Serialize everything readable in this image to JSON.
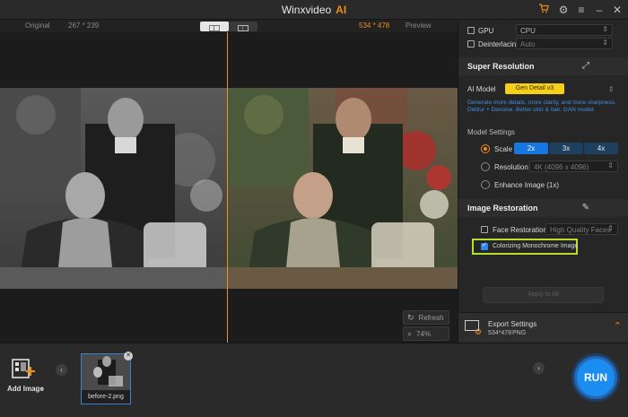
{
  "app": {
    "title": "Winxvideo",
    "title_accent": "AI"
  },
  "titlebar_icons": [
    "cart-icon",
    "gear-icon",
    "menu-icon",
    "minimize-icon",
    "close-icon"
  ],
  "preview_header": {
    "original_label": "Original",
    "original_size": "267 * 239",
    "output_size": "534 * 478",
    "preview_label": "Preview"
  },
  "preview_controls": {
    "refresh": "Refresh",
    "zoom": "74%"
  },
  "settings": {
    "gpu_label": "GPU",
    "gpu_value": "CPU",
    "deinterlacing_label": "Deinterlacing",
    "deinterlacing_value": "Auto"
  },
  "super_resolution": {
    "title": "Super Resolution",
    "ai_model_label": "AI Model",
    "ai_model_value": "Gen Detail v3",
    "description": "Generate more details, more clarity, and more sharpness. Deblur + Denoise. Better skin & hair. GAN model.",
    "model_settings_label": "Model Settings",
    "scale_label": "Scale",
    "scale_options": [
      "2x",
      "3x",
      "4x"
    ],
    "scale_selected": "2x",
    "resolution_label": "Resolution",
    "resolution_value": "4K (4096 x 4096)",
    "enhance_label": "Enhance Image (1x)"
  },
  "image_restoration": {
    "title": "Image Restoration",
    "face_restoration_label": "Face Restoration",
    "face_restoration_value": "High Quality Faces",
    "face_restoration_checked": false,
    "colorize_label": "Colorizing Monochrome Image",
    "colorize_checked": true
  },
  "apply_all_label": "Apply to All",
  "export": {
    "title": "Export Settings",
    "size": "534*478",
    "format": "PNG"
  },
  "bottom": {
    "add_image_label": "Add Image",
    "thumbnail_name": "before-2.png",
    "run_label": "RUN"
  },
  "colors": {
    "accent_orange": "#f08c1a",
    "accent_blue": "#1677e0",
    "highlight_green": "#b6e02a",
    "ai_model_yellow": "#f5cf1a"
  }
}
